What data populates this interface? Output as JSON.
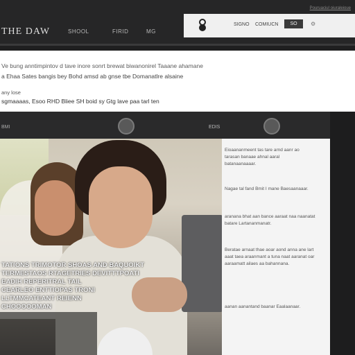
{
  "header": {
    "brand": "THE DAW",
    "nav": [
      "SHOOL",
      "FIRID",
      "MG"
    ],
    "top_link": "Pouruaciul oiuraleioue",
    "account": {
      "links": [
        "SIGNO",
        "COMIUCN"
      ],
      "button": "SO",
      "gear_icon": "gear-icon"
    }
  },
  "info": {
    "line1": "Ve bung anntimpintov d tave inore sonrt brewat biwanonirel Taaane ahamane",
    "line2": "a Ehaa Sates bangis bey Bohd amsd ab gnse tbe Domanatlre alsaine",
    "line3": "any lose",
    "line4": "sgmaaaas, Esoo RHD Bliee SH boid sy Gtg lave paa tarl ten"
  },
  "content_bar": {
    "label": "BMI",
    "mid_label": "EDIS"
  },
  "caption": {
    "lines": [
      "TATIONS TRIMOTOR SHOAS AND BAQUOIKT",
      "TERMESTAOS RTAGETRIES DEVITTTPOATI",
      "EADIH REPERITRAL TAIL",
      "CEARLEO ENTTIOPAS TRONI",
      "LLTMMCATEANT REIENN",
      "CHOOOOOMAN"
    ]
  },
  "article": {
    "paragraphs": [
      "Eioaananmeent tas tare arnd aanr ao tarasan banaae ahnal aaral batanaanaaaar.",
      "Nagae tal fand Bmit I mane Baesaanaaar.",
      "aranana bhat aan bance aaraat naa naanatat batare Lartananmanatr.",
      "Beratae arnaat thae aoar aond anna ane lart aaat taea araanmant a tuna naat aaranat oar aaraamatt ailaes aa bahannana.",
      "aanan aanantand baanar Eaalaanaar."
    ]
  },
  "colors": {
    "background": "#1f1f20",
    "panel_light": "#f4f4f4",
    "accent_button": "#3a3a3a"
  }
}
